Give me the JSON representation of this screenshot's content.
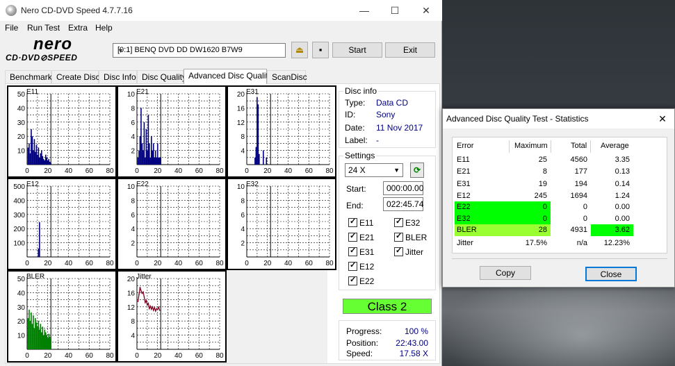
{
  "window": {
    "title": "Nero CD-DVD Speed 4.7.7.16",
    "controls": {
      "minimize": "—",
      "maximize": "☐",
      "close": "✕"
    }
  },
  "menu": [
    "File",
    "Run Test",
    "Extra",
    "Help"
  ],
  "logo": {
    "line1": "nero",
    "line2": "CD·DVD⊘SPEED"
  },
  "toolbar": {
    "drive": "[0:1]   BENQ DVD DD DW1620 B7W9",
    "start": "Start",
    "exit": "Exit"
  },
  "tabs": [
    "Benchmark",
    "Create Disc",
    "Disc Info",
    "Disc Quality",
    "Advanced Disc Quality",
    "ScanDisc"
  ],
  "active_tab": "Advanced Disc Quality",
  "disc_info": {
    "title": "Disc info",
    "rows": [
      {
        "label": "Type:",
        "value": "Data CD"
      },
      {
        "label": "ID:",
        "value": "Sony"
      },
      {
        "label": "Date:",
        "value": "11 Nov 2017"
      },
      {
        "label": "Label:",
        "value": "-"
      }
    ]
  },
  "settings": {
    "title": "Settings",
    "speed": "24 X",
    "start_label": "Start:",
    "start_value": "000:00.00",
    "end_label": "End:",
    "end_value": "022:45.74",
    "checks_left": [
      "E11",
      "E21",
      "E31",
      "E12",
      "E22"
    ],
    "checks_right": [
      "E32",
      "BLER",
      "Jitter"
    ]
  },
  "class_label": "Class 2",
  "progress": {
    "rows": [
      {
        "label": "Progress:",
        "value": "100 %"
      },
      {
        "label": "Position:",
        "value": "22:43.00"
      },
      {
        "label": "Speed:",
        "value": "17.58 X"
      }
    ]
  },
  "colors": {
    "navy": "#000080",
    "green": "#008000",
    "maroon": "#800020",
    "class_green": "#66ff33",
    "hl_green": "#00ff00",
    "bler_green": "#99ff33"
  },
  "chart_data": [
    {
      "name": "E11",
      "type": "bar",
      "xticks": [
        0,
        20,
        40,
        60,
        80
      ],
      "yticks": [
        10,
        20,
        30,
        40,
        50
      ],
      "ylim": [
        0,
        50
      ],
      "color": "#000080",
      "x": [
        1,
        2,
        3,
        4,
        5,
        6,
        7,
        8,
        9,
        10,
        11,
        12,
        13,
        14,
        15,
        16,
        17,
        18,
        19,
        20,
        21,
        22,
        23
      ],
      "values": [
        12,
        15,
        8,
        25,
        20,
        10,
        18,
        9,
        14,
        7,
        12,
        5,
        8,
        10,
        6,
        4,
        3,
        7,
        5,
        3,
        4,
        2,
        1
      ]
    },
    {
      "name": "E21",
      "type": "bar",
      "xticks": [
        0,
        20,
        40,
        60,
        80
      ],
      "yticks": [
        2,
        4,
        6,
        8,
        10
      ],
      "ylim": [
        0,
        10
      ],
      "color": "#000080",
      "x": [
        1,
        2,
        3,
        4,
        5,
        6,
        7,
        8,
        9,
        10,
        11,
        12,
        13,
        14,
        15,
        16,
        17,
        18,
        19,
        20,
        21,
        22,
        23
      ],
      "values": [
        1,
        2,
        4,
        8,
        3,
        2,
        6,
        1,
        5,
        2,
        7,
        3,
        1,
        4,
        2,
        3,
        1,
        2,
        1,
        3,
        1,
        1,
        1
      ]
    },
    {
      "name": "E31",
      "type": "bar",
      "xticks": [
        0,
        20,
        40,
        60,
        80
      ],
      "yticks": [
        4,
        8,
        12,
        16,
        20
      ],
      "ylim": [
        0,
        20
      ],
      "color": "#000080",
      "x": [
        8,
        9,
        10,
        11,
        12,
        16,
        19
      ],
      "values": [
        2,
        5,
        19,
        17,
        3,
        4,
        2
      ]
    },
    {
      "name": "E12",
      "type": "bar",
      "xticks": [
        0,
        20,
        40,
        60,
        80
      ],
      "yticks": [
        100,
        200,
        300,
        400,
        500
      ],
      "ylim": [
        0,
        500
      ],
      "color": "#000080",
      "x": [
        11,
        12
      ],
      "values": [
        60,
        245
      ]
    },
    {
      "name": "E22",
      "type": "bar",
      "xticks": [
        0,
        20,
        40,
        60,
        80
      ],
      "yticks": [
        2,
        4,
        6,
        8,
        10
      ],
      "ylim": [
        0,
        10
      ],
      "color": "#000080",
      "x": [],
      "values": []
    },
    {
      "name": "E32",
      "type": "bar",
      "xticks": [
        0,
        20,
        40,
        60,
        80
      ],
      "yticks": [
        2,
        4,
        6,
        8,
        10
      ],
      "ylim": [
        0,
        10
      ],
      "color": "#000080",
      "x": [],
      "values": []
    },
    {
      "name": "BLER",
      "type": "bar",
      "xticks": [
        0,
        20,
        40,
        60,
        80
      ],
      "yticks": [
        10,
        20,
        30,
        40,
        50
      ],
      "ylim": [
        0,
        50
      ],
      "color": "#008000",
      "x": [
        1,
        2,
        3,
        4,
        5,
        6,
        7,
        8,
        9,
        10,
        11,
        12,
        13,
        14,
        15,
        16,
        17,
        18,
        19,
        20,
        21,
        22,
        23
      ],
      "values": [
        22,
        28,
        20,
        26,
        18,
        24,
        15,
        22,
        19,
        16,
        20,
        14,
        18,
        12,
        16,
        10,
        14,
        12,
        10,
        8,
        11,
        9,
        7
      ]
    },
    {
      "name": "Jitter",
      "type": "line",
      "xticks": [
        0,
        20,
        40,
        60,
        80
      ],
      "yticks": [
        4,
        8,
        12,
        16,
        20
      ],
      "ylim": [
        0,
        20
      ],
      "color": "#800020",
      "x": [
        1,
        2,
        3,
        4,
        5,
        6,
        7,
        8,
        9,
        10,
        11,
        12,
        13,
        14,
        15,
        16,
        17,
        18,
        19,
        20,
        21,
        22
      ],
      "values": [
        13.5,
        15.5,
        17.5,
        16.5,
        15.8,
        16.2,
        14.8,
        13.2,
        13.8,
        12.5,
        13,
        11.5,
        12.2,
        11.3,
        12,
        11,
        11.8,
        10.8,
        11.5,
        11.2,
        11.9,
        11
      ]
    }
  ],
  "stats_dialog": {
    "title": "Advanced Disc Quality Test - Statistics",
    "columns": [
      "Error",
      "Maximum",
      "Total",
      "Average"
    ],
    "rows": [
      {
        "error": "E11",
        "maximum": "25",
        "total": "4560",
        "average": "3.35"
      },
      {
        "error": "E21",
        "maximum": "8",
        "total": "177",
        "average": "0.13"
      },
      {
        "error": "E31",
        "maximum": "19",
        "total": "194",
        "average": "0.14"
      },
      {
        "error": "E12",
        "maximum": "245",
        "total": "1694",
        "average": "1.24"
      },
      {
        "error": "E22",
        "maximum": "0",
        "total": "0",
        "average": "0.00"
      },
      {
        "error": "E32",
        "maximum": "0",
        "total": "0",
        "average": "0.00"
      },
      {
        "error": "BLER",
        "maximum": "28",
        "total": "4931",
        "average": "3.62"
      },
      {
        "error": "Jitter",
        "maximum": "17.5%",
        "total": "n/a",
        "average": "12.23%"
      }
    ],
    "copy": "Copy",
    "close": "Close"
  }
}
